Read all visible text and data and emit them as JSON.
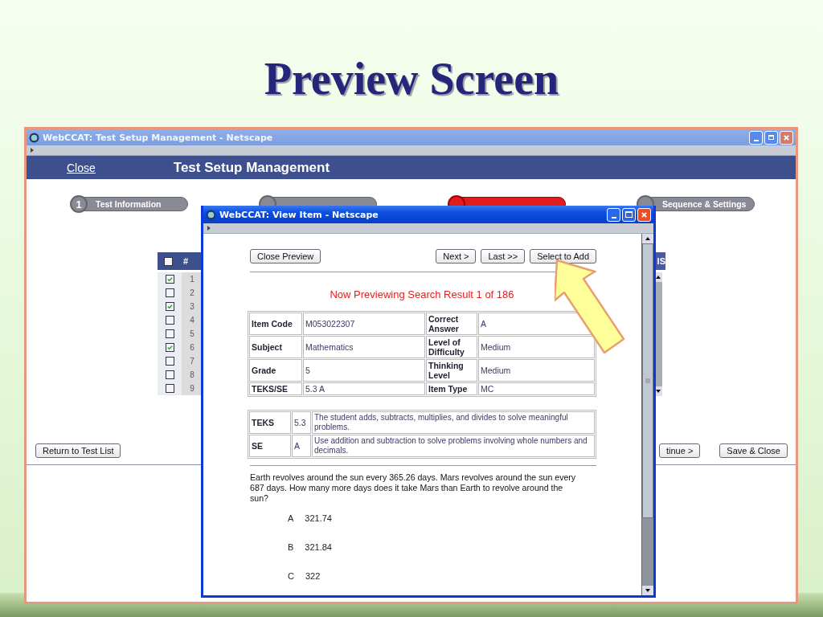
{
  "slide": {
    "title": "Preview Screen"
  },
  "window": {
    "title": "WebCCAT: Test Setup Management - Netscape",
    "close_link": "Close",
    "heading": "Test Setup Management",
    "steps": [
      {
        "number": "1",
        "label": "Test Information",
        "selected": false
      },
      {
        "selected": false
      },
      {
        "selected": true
      },
      {
        "label": "Sequence & Settings",
        "selected": false
      }
    ],
    "item_table": {
      "header_checked": false,
      "number_heading": "#",
      "rows": [
        {
          "number": "1",
          "checked": true
        },
        {
          "number": "2",
          "checked": false
        },
        {
          "number": "3",
          "checked": true
        },
        {
          "number": "4",
          "checked": false
        },
        {
          "number": "5",
          "checked": false
        },
        {
          "number": "6",
          "checked": true
        },
        {
          "number": "7",
          "checked": false
        },
        {
          "number": "8",
          "checked": false
        },
        {
          "number": "9",
          "checked": false
        }
      ]
    },
    "column_3": {
      "heading": "IS"
    },
    "left_button": "Return to Test List",
    "right_buttons": [
      "tinue >",
      "Save & Close"
    ]
  },
  "popup": {
    "title": "WebCCAT: View Item - Netscape",
    "left_button": "Close Preview",
    "right_buttons": [
      "Next >",
      "Last >>",
      "Select to Add"
    ],
    "status": "Now Previewing Search Result 1 of 186",
    "details": [
      [
        "Item Code",
        "M053022307",
        "Correct Answer",
        "A"
      ],
      [
        "Subject",
        "Mathematics",
        "Level of Difficulty",
        "Medium"
      ],
      [
        "Grade",
        "5",
        "Thinking Level",
        "Medium"
      ],
      [
        "TEKS/SE",
        "5.3 A",
        "Item Type",
        "MC"
      ]
    ],
    "standards": [
      {
        "label": "TEKS",
        "code": "5.3",
        "text": "The student adds, subtracts, multiplies, and divides to solve meaningful problems."
      },
      {
        "label": "SE",
        "code": "A",
        "text": "Use addition and subtraction to solve problems involving whole numbers and decimals."
      }
    ],
    "question": "Earth revolves around the sun every 365.26 days. Mars revolves around the sun every 687 days. How many more days does it take Mars than Earth to revolve around the sun?",
    "choices": [
      {
        "letter": "A",
        "text": "321.74"
      },
      {
        "letter": "B",
        "text": "321.84"
      },
      {
        "letter": "C",
        "text": "322"
      }
    ]
  }
}
